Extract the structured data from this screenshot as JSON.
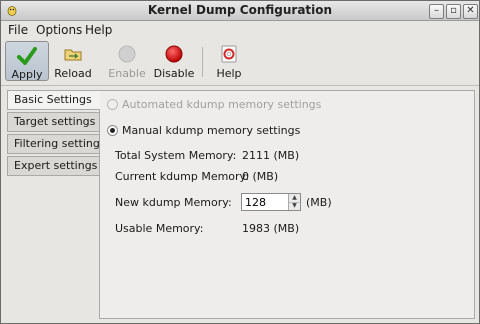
{
  "window": {
    "title": "Kernel Dump Configuration"
  },
  "menu": {
    "file": "File",
    "options": "Options",
    "help": "Help"
  },
  "toolbar": {
    "apply": "Apply",
    "reload": "Reload",
    "enable": "Enable",
    "disable": "Disable",
    "help": "Help"
  },
  "tabs": [
    "Basic Settings",
    "Target settings",
    "Filtering settings",
    "Expert settings"
  ],
  "basic": {
    "automated_label": "Automated kdump memory settings",
    "manual_label": "Manual kdump memory settings",
    "total_label": "Total System Memory:",
    "total_value": "2111 (MB)",
    "current_label": "Current kdump Memory:",
    "current_value": "0 (MB)",
    "new_label": "New kdump Memory:",
    "new_value": "128",
    "new_unit": "(MB)",
    "usable_label": "Usable Memory:",
    "usable_value": "1983 (MB)"
  },
  "colors": {
    "accent_green": "#2a9a1a",
    "disable_red": "#d01010",
    "selection": "#b9c4cf"
  }
}
